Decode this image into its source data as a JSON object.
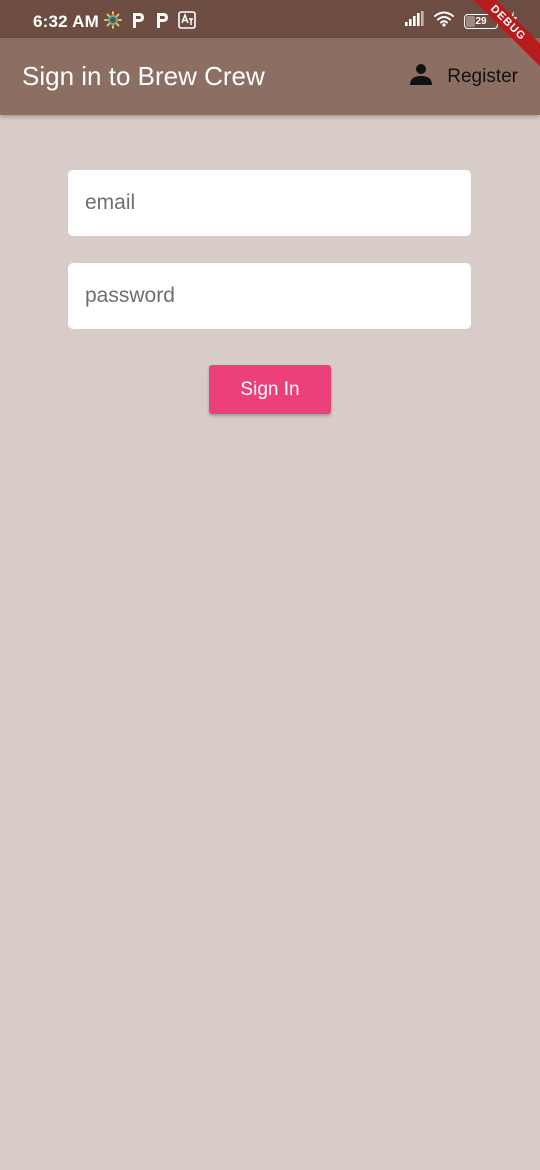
{
  "status_bar": {
    "time": "6:32 AM",
    "battery_level": "29"
  },
  "app_bar": {
    "title": "Sign in to Brew Crew",
    "register_label": "Register"
  },
  "debug_banner": {
    "label": "DEBUG"
  },
  "form": {
    "email_placeholder": "email",
    "password_placeholder": "password",
    "sign_in_label": "Sign In"
  },
  "colors": {
    "status_bar": "#6d4c41",
    "app_bar": "#8d6e63",
    "background": "#d7ccc8",
    "accent": "#ec407a"
  },
  "icons": {
    "status_left": [
      "app-notification-icon",
      "pinterest-icon",
      "pinterest-icon",
      "translate-icon"
    ],
    "status_right": [
      "signal-icon",
      "wifi-icon",
      "battery-icon",
      "charging-icon"
    ],
    "app_bar": [
      "person-icon"
    ]
  }
}
